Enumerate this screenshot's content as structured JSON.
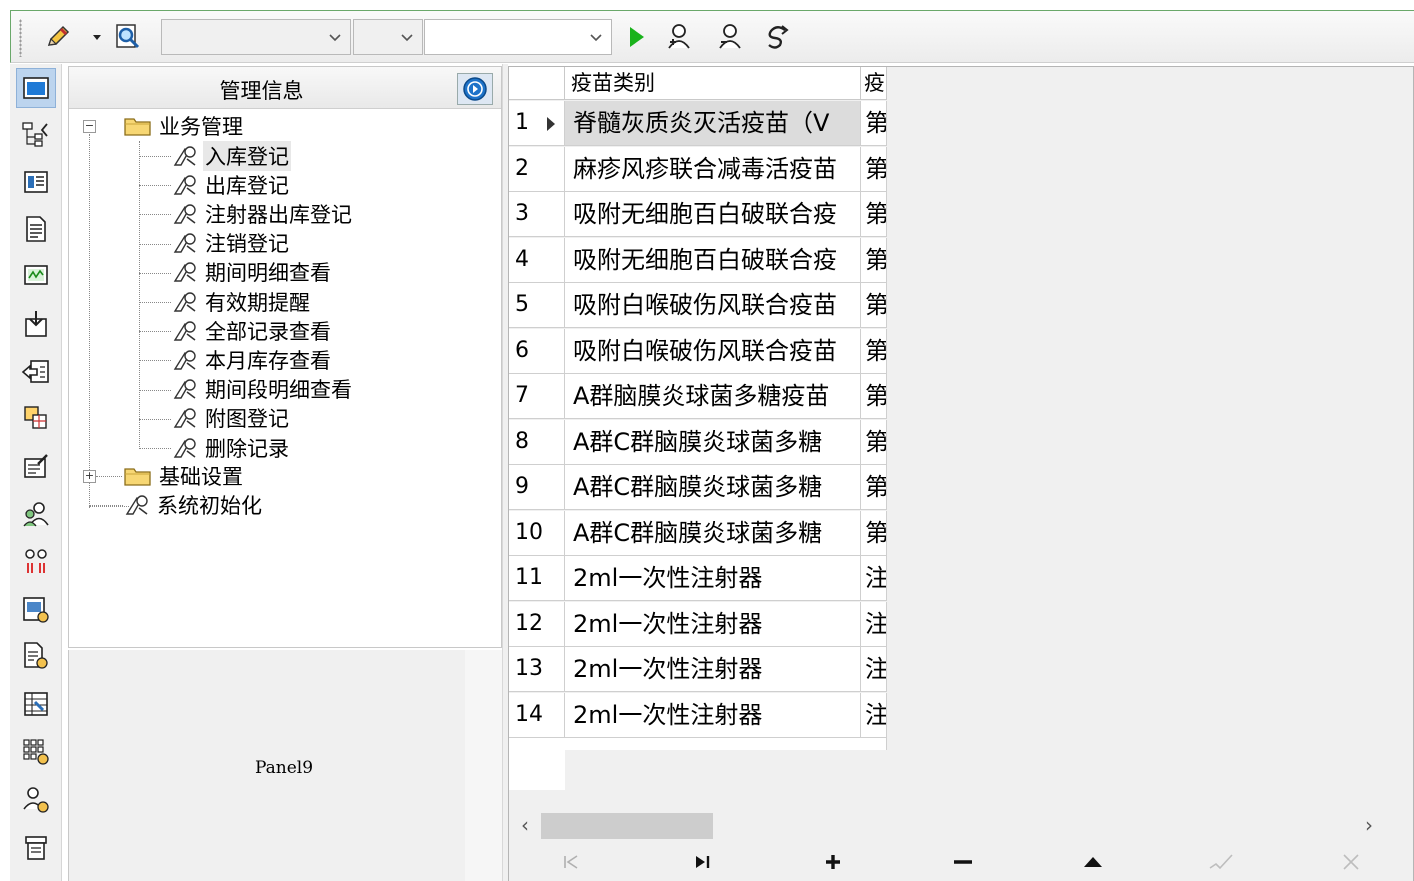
{
  "toolbar": {
    "combo1_value": "",
    "combo2_value": "",
    "combo3_value": ""
  },
  "tree": {
    "title": "管理信息",
    "root": "业务管理",
    "children": [
      "入库登记",
      "出库登记",
      "注射器出库登记",
      "注销登记",
      "期间明细查看",
      "有效期提醒",
      "全部记录查看",
      "本月库存查看",
      "期间段明细查看",
      "附图登记",
      "删除记录"
    ],
    "base_settings": "基础设置",
    "system_init": "系统初始化"
  },
  "panel9": {
    "label": "Panel9"
  },
  "grid": {
    "headers": [
      "疫苗类别",
      "疫"
    ],
    "rows": [
      {
        "num": "1",
        "name": "脊髓灰质炎灭活疫苗（V",
        "type": "第"
      },
      {
        "num": "2",
        "name": "麻疹风疹联合减毒活疫苗",
        "type": "第"
      },
      {
        "num": "3",
        "name": "吸附无细胞百白破联合疫",
        "type": "第"
      },
      {
        "num": "4",
        "name": "吸附无细胞百白破联合疫",
        "type": "第"
      },
      {
        "num": "5",
        "name": "吸附白喉破伤风联合疫苗",
        "type": "第"
      },
      {
        "num": "6",
        "name": "吸附白喉破伤风联合疫苗",
        "type": "第"
      },
      {
        "num": "7",
        "name": "A群脑膜炎球菌多糖疫苗",
        "type": "第"
      },
      {
        "num": "8",
        "name": "A群C群脑膜炎球菌多糖",
        "type": "第"
      },
      {
        "num": "9",
        "name": "A群C群脑膜炎球菌多糖",
        "type": "第"
      },
      {
        "num": "10",
        "name": "A群C群脑膜炎球菌多糖",
        "type": "第"
      },
      {
        "num": "11",
        "name": "2ml一次性注射器",
        "type": "注"
      },
      {
        "num": "12",
        "name": "2ml一次性注射器",
        "type": "注"
      },
      {
        "num": "13",
        "name": "2ml一次性注射器",
        "type": "注"
      },
      {
        "num": "14",
        "name": "2ml一次性注射器",
        "type": "注"
      }
    ],
    "current_row": 0
  },
  "navigator": {
    "first": "first-record-icon",
    "last": "last-record-icon",
    "insert": "plus-icon",
    "delete": "minus-icon",
    "edit": "triangle-up-icon",
    "post": "check-icon",
    "cancel": "cross-icon"
  },
  "colors": {
    "selection": "#bcd4ee",
    "run": "#19b21b"
  }
}
